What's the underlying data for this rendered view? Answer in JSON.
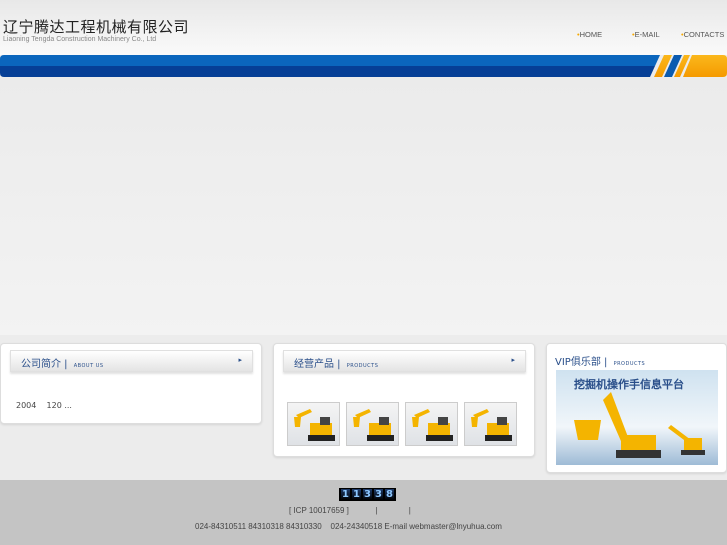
{
  "header": {
    "title": "辽宁腾达工程机械有限公司",
    "subtitle": "Liaoning Tengda Construction Machinery Co., Ltd"
  },
  "nav": [
    {
      "label": "HOME"
    },
    {
      "label": "E-MAIL"
    },
    {
      "label": "CONTACTS"
    }
  ],
  "about": {
    "title": "公司简介",
    "title_en": "ABOUT US",
    "text": "2004    120 ..."
  },
  "products": {
    "title": "经营产品",
    "title_en": "PRODUCTS",
    "items": [
      "excavator-1",
      "excavator-2",
      "excavator-3",
      "excavator-4"
    ]
  },
  "vip": {
    "title": "VIP俱乐部",
    "title_en": "PRODUCTS",
    "banner_text": "挖掘机操作手信息平台"
  },
  "footer": {
    "counter": [
      "1",
      "1",
      "3",
      "3",
      "8"
    ],
    "icp": "[ ICP 10017659 ]            |              |",
    "contact": "024-84310511 84310318 84310330    024-24340518 E-mail webmaster@lnyuhua.com"
  },
  "colors": {
    "blue": "#0b5bb0",
    "orange": "#f6a800"
  }
}
